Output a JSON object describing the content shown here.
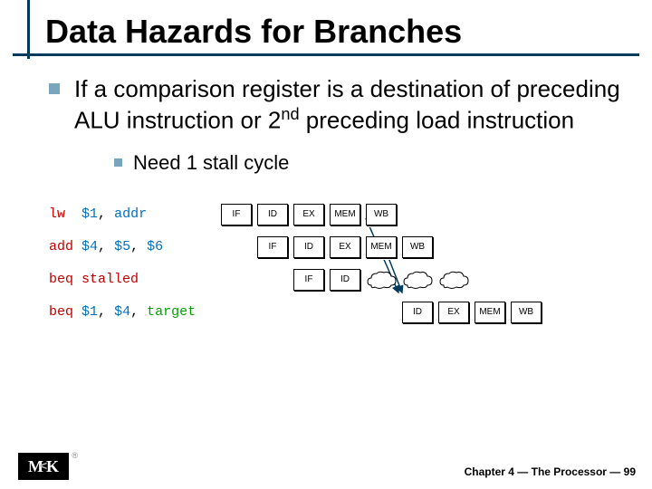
{
  "title": "Data Hazards for Branches",
  "bullet1_pre": "If a comparison register is a destination of preceding ALU instruction or 2",
  "bullet1_sup": "nd",
  "bullet1_post": " preceding load instruction",
  "bullet2": "Need 1 stall cycle",
  "rows": [
    {
      "op": "lw",
      "mid": "  ",
      "arg0": "$1",
      "sep": ", ",
      "arg1": "addr",
      "arg1_class": "reg",
      "offset": 190,
      "stages": [
        "IF",
        "ID",
        "EX",
        "MEM",
        "WB"
      ]
    },
    {
      "op": "add",
      "mid": " ",
      "arg0": "$4",
      "sep": ", ",
      "arg1": "$5",
      "sep2": ", ",
      "arg2": "$6",
      "offset": 230,
      "stages": [
        "IF",
        "ID",
        "EX",
        "MEM",
        "WB"
      ]
    },
    {
      "op": "beq",
      "mid": " ",
      "stalled": "stalled",
      "offset": 270,
      "stages": [
        "IF",
        "ID"
      ],
      "clouds": 3
    },
    {
      "op": "beq",
      "mid": " ",
      "arg0": "$1",
      "sep": ", ",
      "arg1": "$4",
      "arg1_class": "reg",
      "sep2": ", ",
      "arg2t": "target",
      "offset": 390,
      "stages": [
        "ID",
        "EX",
        "MEM",
        "WB"
      ]
    }
  ],
  "stage_labels": {
    "IF": "IF",
    "ID": "ID",
    "EX": "EX",
    "MEM": "MEM",
    "WB": "WB"
  },
  "footer": "Chapter 4 — The Processor — 99",
  "logo": {
    "m": "M",
    "k": "K",
    "reg": "®"
  }
}
